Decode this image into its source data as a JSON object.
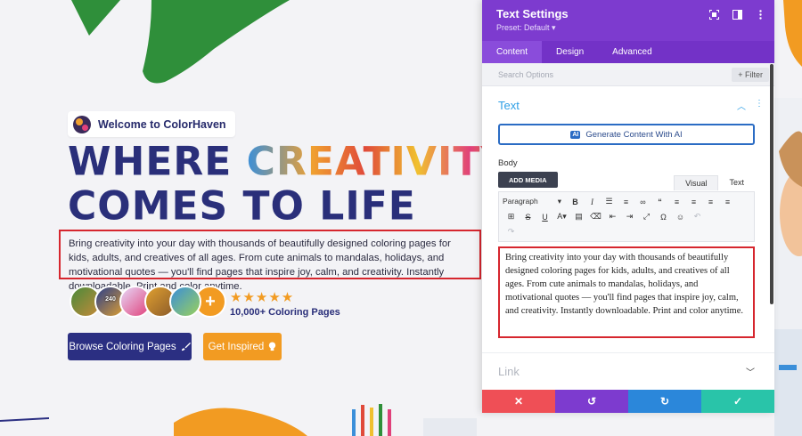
{
  "hero": {
    "welcome": "Welcome to ColorHaven",
    "headline_line1_part1": "WHERE ",
    "headline_line1_part2": "CREATIVITY",
    "headline_line2": "COMES TO LIFE",
    "body": "Bring creativity into your day with thousands of beautifully designed coloring pages for kids, adults, and creatives of all ages. From cute animals to mandalas, holidays, and motivational quotes — you'll find pages that inspire joy, calm, and creativity. Instantly downloadable. Print and color anytime.",
    "avatar_labels": [
      "",
      "240",
      "",
      "",
      ""
    ],
    "avatar_plus": "+",
    "stars": "★★★★★",
    "rating_text": "10,000+ Coloring Pages",
    "primary_button": "Browse Coloring Pages",
    "secondary_button": "Get Inspired"
  },
  "panel": {
    "title": "Text Settings",
    "preset": "Preset: Default ▾",
    "tabs": [
      {
        "label": "Content",
        "active": true
      },
      {
        "label": "Design",
        "active": false
      },
      {
        "label": "Advanced",
        "active": false
      }
    ],
    "search_placeholder": "Search Options",
    "filter": "+ Filter",
    "section_title": "Text",
    "ai_badge": "AI",
    "ai_button": "Generate Content With AI",
    "body_label": "Body",
    "add_media": "ADD MEDIA",
    "mode_visual": "Visual",
    "mode_text": "Text",
    "format_select": "Paragraph",
    "editor_text": "Bring creativity into your day with thousands of beautifully designed coloring pages for kids, adults, and creatives of all ages. From cute animals to mandalas, holidays, and motivational quotes — you'll find pages that inspire joy, calm, and creativity. Instantly downloadable. Print and color anytime.",
    "link_title": "Link"
  },
  "colors": {
    "panel_purple": "#7d3bcf",
    "brand_navy": "#2b2f82",
    "accent_orange": "#f29b22",
    "cancel_red": "#ef4f56",
    "undo_purple": "#7d3bcf",
    "redo_blue": "#2b87da",
    "save_green": "#29c4a9",
    "highlight_red": "#d6262e"
  }
}
